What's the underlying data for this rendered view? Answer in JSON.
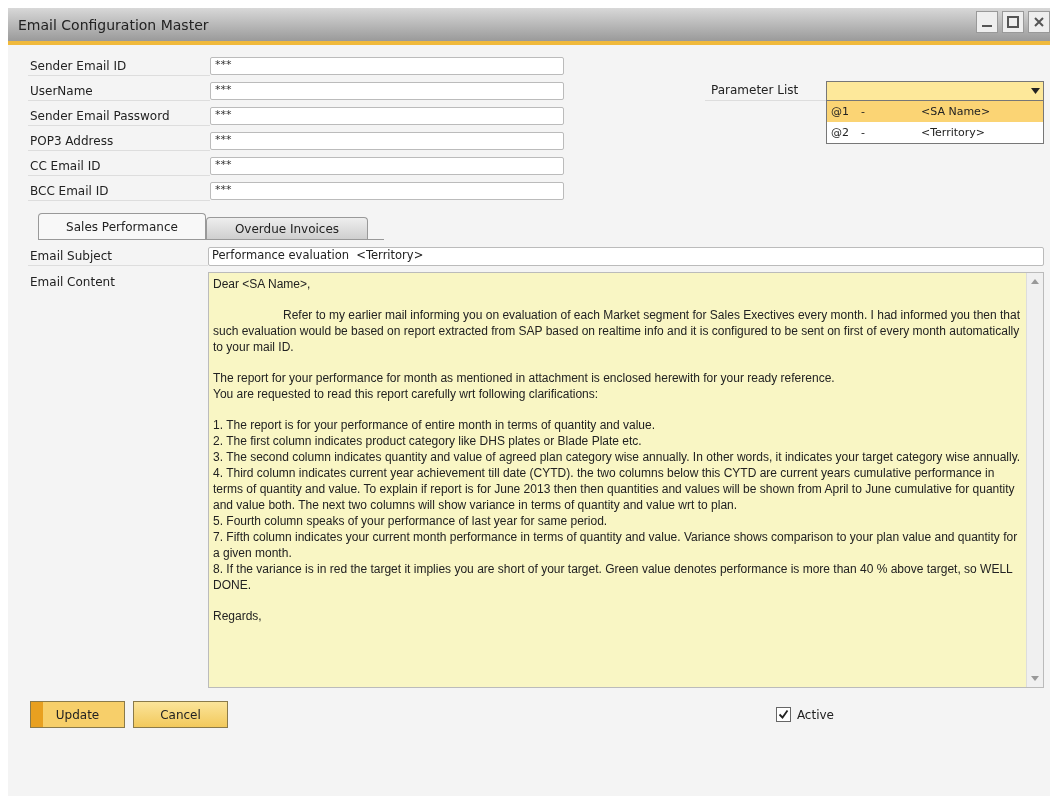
{
  "window": {
    "title": "Email Configuration Master"
  },
  "fields": [
    {
      "label": "Sender Email ID",
      "value": "***"
    },
    {
      "label": "UserName",
      "value": "***"
    },
    {
      "label": "Sender Email Password",
      "value": "***"
    },
    {
      "label": "POP3 Address",
      "value": "***"
    },
    {
      "label": "CC Email ID",
      "value": "***"
    },
    {
      "label": "BCC Email ID",
      "value": "***"
    }
  ],
  "parameter_list": {
    "label": "Parameter List",
    "expanded": true,
    "options": [
      {
        "code": "@1",
        "separator": "-",
        "name": "<SA Name>",
        "selected": true
      },
      {
        "code": "@2",
        "separator": "-",
        "name": "<Territory>",
        "selected": false
      }
    ]
  },
  "tabs": [
    {
      "label": "Sales Performance",
      "selected": true
    },
    {
      "label": "Overdue Invoices",
      "selected": false
    }
  ],
  "email_subject": {
    "label": "Email Subject",
    "value": "Performance evaluation  <Territory>"
  },
  "email_content": {
    "label": "Email Content",
    "paragraphs": [
      {
        "indented": false,
        "lines": [
          "Dear <SA Name>,"
        ]
      },
      {
        "indented": true,
        "lines": [
          "Refer to my earlier mail informing you on evaluation of each Market segment for Sales Exectives every month. I had informed you then that such evaluation would be based on report extracted from SAP based on realtime info and it is configured to be sent on first of every month automatically to your mail ID."
        ]
      },
      {
        "indented": false,
        "lines": [
          "The report for your performance for month as mentioned in attachment is enclosed herewith for your ready reference.",
          "You are requested to read this report carefully wrt following clarifications:"
        ]
      },
      {
        "indented": false,
        "lines": [
          "1. The report is for your performance of entire month in terms of quantity and value.",
          "2. The first column indicates product category like DHS plates or Blade Plate etc.",
          "3. The second column indicates quantity and value of agreed plan category wise annually. In other words, it indicates your target category wise annually.",
          "4. Third column indicates current year achievement till date (CYTD). the two columns below this CYTD are current years cumulative performance in terms of quantity and value. To explain if report is for June 2013 then then quantities and values will be shown from April to June cumulative for quantity and value both. The next two columns will show variance in terms of quantity and value wrt to plan.",
          "5. Fourth column speaks of your performance of last year for same period.",
          "7. Fifth column indicates your current month performance in terms of quantity and value. Variance shows comparison to your plan value and quantity for a given month.",
          "8. If the variance is in red the target it implies you are short of your target. Green value denotes performance is more than 40 % above target, so WELL DONE."
        ]
      },
      {
        "indented": false,
        "lines": [
          "Regards,"
        ]
      }
    ]
  },
  "buttons": [
    {
      "label": "Update",
      "kind": "primary"
    },
    {
      "label": "Cancel",
      "kind": "secondary"
    }
  ],
  "active": {
    "label": "Active",
    "checked": true
  }
}
